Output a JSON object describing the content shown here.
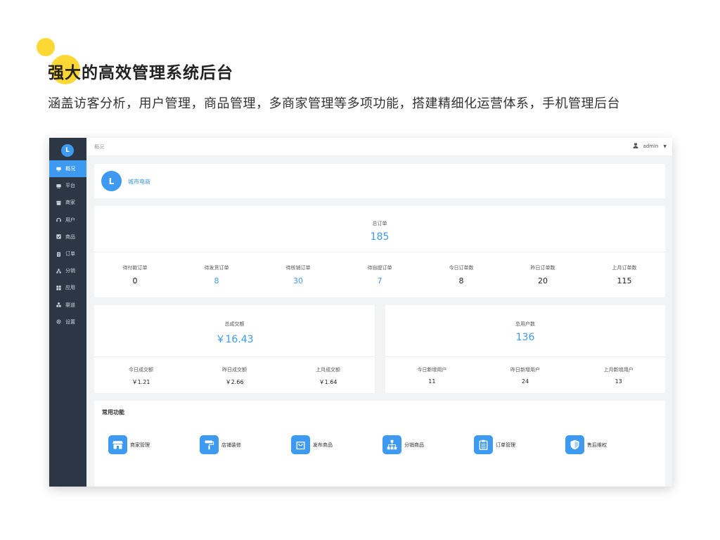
{
  "hero": {
    "title": "强大的高效管理系统后台",
    "subtitle": "涵盖访客分析，用户管理，商品管理，多商家管理等多项功能，搭建精细化运营体系，手机管理后台"
  },
  "sidebar": {
    "logo_text": "L",
    "items": [
      {
        "label": "概况",
        "icon": "monitor-icon",
        "active": true
      },
      {
        "label": "平台",
        "icon": "platform-icon"
      },
      {
        "label": "商家",
        "icon": "store-icon"
      },
      {
        "label": "用户",
        "icon": "headset-icon"
      },
      {
        "label": "商品",
        "icon": "checkbox-icon"
      },
      {
        "label": "订单",
        "icon": "clipboard-icon"
      },
      {
        "label": "分销",
        "icon": "hierarchy-icon"
      },
      {
        "label": "应用",
        "icon": "apps-grid-icon"
      },
      {
        "label": "渠道",
        "icon": "cubes-icon"
      },
      {
        "label": "设置",
        "icon": "gear-icon"
      }
    ]
  },
  "topbar": {
    "breadcrumb": "概况",
    "username": "admin"
  },
  "shop": {
    "logo_text": "L",
    "name": "城市电商"
  },
  "orders": {
    "total_label": "总订单",
    "total_value": "185",
    "stats": [
      {
        "label": "待付款订单",
        "value": "0",
        "highlight": false
      },
      {
        "label": "待发货订单",
        "value": "8",
        "highlight": true
      },
      {
        "label": "待核销订单",
        "value": "30",
        "highlight": true
      },
      {
        "label": "待自提订单",
        "value": "7",
        "highlight": true
      },
      {
        "label": "今日订单数",
        "value": "8",
        "highlight": false
      },
      {
        "label": "昨日订单数",
        "value": "20",
        "highlight": false
      },
      {
        "label": "上月订单数",
        "value": "115",
        "highlight": false
      }
    ]
  },
  "amount": {
    "total_label": "总成交额",
    "total_value": "￥16.43",
    "stats": [
      {
        "label": "今日成交额",
        "value": "￥1.21"
      },
      {
        "label": "昨日成交额",
        "value": "￥2.66"
      },
      {
        "label": "上月成交额",
        "value": "￥1.64"
      }
    ]
  },
  "users": {
    "total_label": "总用户数",
    "total_value": "136",
    "stats": [
      {
        "label": "今日新增用户",
        "value": "11"
      },
      {
        "label": "昨日新增用户",
        "value": "24"
      },
      {
        "label": "上月新增用户",
        "value": "13"
      }
    ]
  },
  "features": {
    "title": "常用功能",
    "items": [
      {
        "label": "商家管理",
        "icon": "store-icon"
      },
      {
        "label": "店铺装修",
        "icon": "paint-roller-icon"
      },
      {
        "label": "发布商品",
        "icon": "shopping-bag-icon"
      },
      {
        "label": "分销商品",
        "icon": "hierarchy-icon"
      },
      {
        "label": "订单管理",
        "icon": "clipboard-list-icon"
      },
      {
        "label": "售后维权",
        "icon": "shield-icon"
      }
    ]
  },
  "colors": {
    "accent": "#3d9af0",
    "sidebar_bg": "#2c3644",
    "hero_yellow": "#fdd835"
  }
}
